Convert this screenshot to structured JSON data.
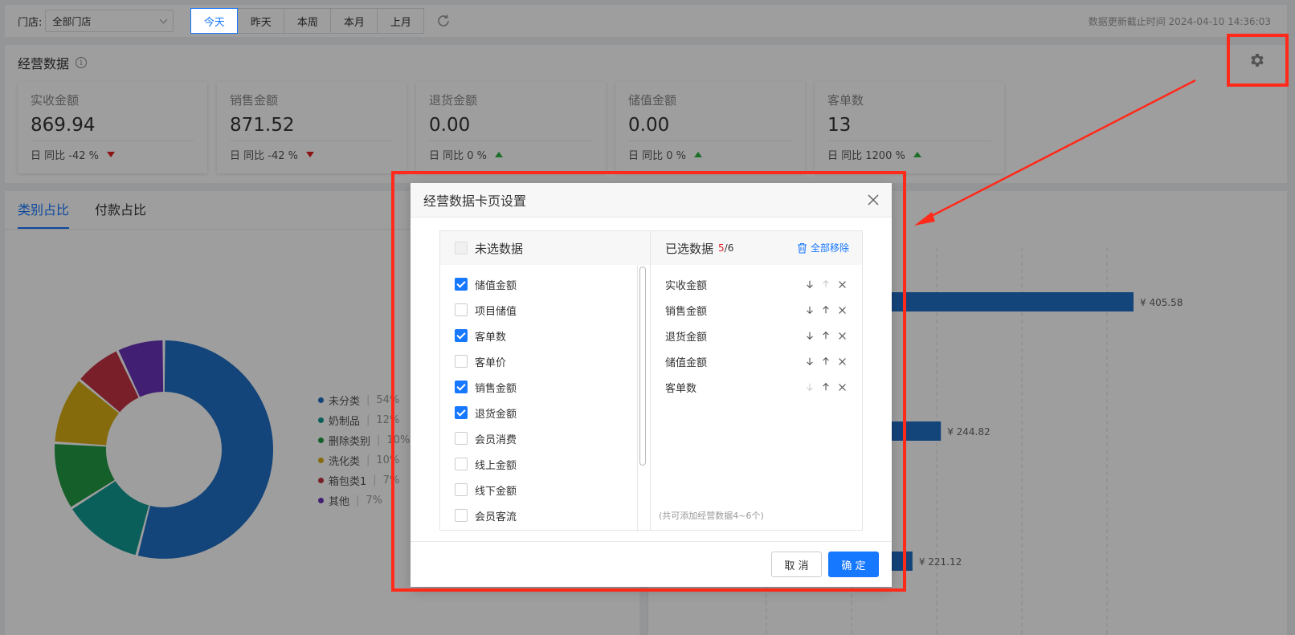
{
  "filter": {
    "store_label": "门店:",
    "store_value": "全部门店",
    "ranges": [
      "今天",
      "昨天",
      "本周",
      "本月",
      "上月"
    ],
    "active_range": "今天",
    "update_time": "数据更新截止时间 2024-04-10 14:36:03"
  },
  "biz": {
    "title": "经营数据",
    "cards": [
      {
        "label": "实收金额",
        "value": "869.94",
        "compare": "日 同比 -42 %",
        "trend": "down"
      },
      {
        "label": "销售金额",
        "value": "871.52",
        "compare": "日 同比 -42 %",
        "trend": "down"
      },
      {
        "label": "退货金额",
        "value": "0.00",
        "compare": "日 同比 0 %",
        "trend": "up"
      },
      {
        "label": "储值金额",
        "value": "0.00",
        "compare": "日 同比 0 %",
        "trend": "up"
      },
      {
        "label": "客单数",
        "value": "13",
        "compare": "日 同比 1200 %",
        "trend": "up"
      }
    ]
  },
  "tabs": [
    "类别占比",
    "付款占比"
  ],
  "chart_data": [
    {
      "type": "pie",
      "categories": [
        "未分类",
        "奶制品",
        "删除类别",
        "洗化类",
        "箱包类1",
        "其他"
      ],
      "values": [
        54,
        12,
        10,
        10,
        7,
        7
      ],
      "value_labels": [
        "54%",
        "12%",
        "10%",
        "10%",
        "7%",
        "7%"
      ],
      "colors": [
        "#1f6fc5",
        "#139a94",
        "#229a44",
        "#d7ad12",
        "#c43245",
        "#6a33b8"
      ],
      "legend": "right"
    },
    {
      "type": "bar",
      "orientation": "horizontal",
      "values": [
        405.58,
        244.82,
        221.12
      ],
      "value_labels": [
        "¥ 405.58",
        "¥ 244.82",
        "¥ 221.12"
      ],
      "color": "#1f6fc5",
      "grid": true
    }
  ],
  "modal": {
    "title": "经营数据卡页设置",
    "unselected_title": "未选数据",
    "options": [
      {
        "label": "储值金额",
        "checked": true
      },
      {
        "label": "项目储值",
        "checked": false
      },
      {
        "label": "客单数",
        "checked": true
      },
      {
        "label": "客单价",
        "checked": false
      },
      {
        "label": "销售金额",
        "checked": true
      },
      {
        "label": "退货金额",
        "checked": true
      },
      {
        "label": "会员消费",
        "checked": false
      },
      {
        "label": "线上金额",
        "checked": false
      },
      {
        "label": "线下金额",
        "checked": false
      },
      {
        "label": "会员客流",
        "checked": false
      }
    ],
    "selected_title": "已选数据",
    "selected_count": "5",
    "selected_total": "/6",
    "remove_all": "全部移除",
    "selected": [
      "实收金额",
      "销售金额",
      "退货金额",
      "储值金额",
      "客单数"
    ],
    "hint": "(共可添加经营数据4~6个)",
    "cancel": "取 消",
    "ok": "确 定"
  }
}
